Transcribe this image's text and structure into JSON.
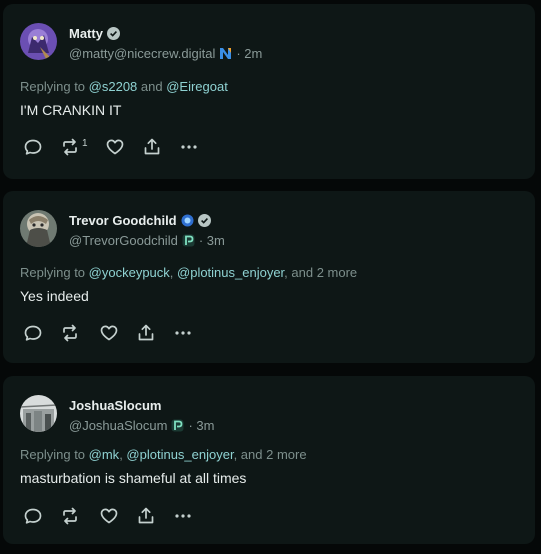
{
  "posts": [
    {
      "display_name": "Matty",
      "handle": "@matty@nicecrew.digital",
      "time": "· 2m",
      "reply_prefix": "Replying to ",
      "mentions": [
        "@s2208",
        "@Eiregoat"
      ],
      "reply_joiner": " and ",
      "reply_suffix": "",
      "body": "I'M CRANKIN IT",
      "repost_count": "1",
      "verified": true,
      "client_icon": "n-logo-icon"
    },
    {
      "display_name": "Trevor Goodchild",
      "handle": "@TrevorGoodchild",
      "time": "· 3m",
      "reply_prefix": "Replying to ",
      "mentions": [
        "@yockeypuck",
        "@plotinus_enjoyer"
      ],
      "reply_joiner": ", ",
      "reply_suffix": ", and 2 more",
      "body": "Yes indeed",
      "repost_count": "",
      "verified": true,
      "client_icon": "p-logo-icon"
    },
    {
      "display_name": "JoshuaSlocum",
      "handle": "@JoshuaSlocum",
      "time": "· 3m",
      "reply_prefix": "Replying to ",
      "mentions": [
        "@mk",
        "@plotinus_enjoyer"
      ],
      "reply_joiner": ", ",
      "reply_suffix": ", and 2 more",
      "body": "masturbation is shameful at all times",
      "repost_count": "",
      "verified": false,
      "client_icon": "p-logo-icon"
    }
  ],
  "icons": {
    "reply": "reply-icon",
    "repost": "repost-icon",
    "like": "heart-icon",
    "share": "share-icon",
    "more": "more-icon"
  },
  "colors": {
    "background": "#050808",
    "card": "#0e1716",
    "mention": "#8fd2d2",
    "muted": "#8a9a98",
    "text": "#e6eceb"
  }
}
